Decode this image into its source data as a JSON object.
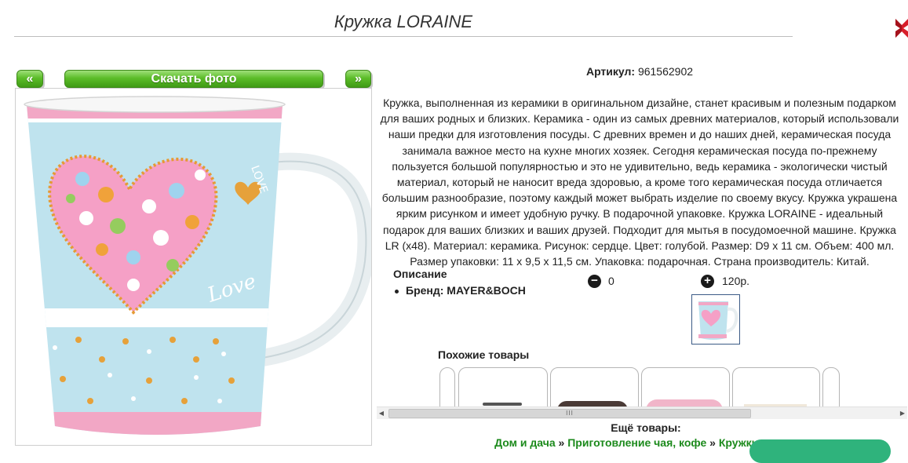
{
  "header": {
    "title": "Кружка LORAINE"
  },
  "nav": {
    "prev_label": "«",
    "download_label": "Скачать фото",
    "next_label": "»"
  },
  "product": {
    "article_label": "Артикул:",
    "article_value": "961562902",
    "description": "Кружка, выполненная из керамики в оригинальном дизайне, станет красивым и полезным подарком для ваших родных и близких. Керамика - один из самых древних материалов, который использовали наши предки для изготовления посуды. С древних времен и до наших дней, керамическая посуда занимала важное место на кухне многих хозяек. Сегодня керамическая посуда по-прежнему пользуется большой популярностью и это не удивительно, ведь керамика - экологически чистый материал, который не наносит вреда здоровью, а кроме того керамическая посуда отличается большим разнообразие, поэтому каждый может выбрать изделие по своему вкусу. Кружка украшена ярким рисунком и имеет удобную ручку. В подарочной упаковке. Кружка LORAINE - идеальный подарок для ваших близких и ваших друзей. Подходит для мытья в посудомоечной машине. Кружка LR (х48). Материал: керамика. Рисунок: сердце. Цвет: голубой. Размер: D9 х 11 см. Объем: 400 мл. Размер упаковки: 11 х 9,5 х 11,5 см. Упаковка: подарочная. Страна производитель: Китай.",
    "description_label": "Описание",
    "brand_item": "Бренд: MAYER&BOCH",
    "quantity": "0",
    "price": "120р.",
    "minus_symbol": "−",
    "plus_symbol": "+"
  },
  "similar": {
    "label": "Похожие товары",
    "scroll_grip": "III",
    "scroll_left": "◀",
    "scroll_right": "▶"
  },
  "more": {
    "label": "Ещё товары:",
    "breadcrumb": [
      "Дом и дача",
      "Приготовление чая, кофе",
      "Кружки и чашки"
    ],
    "separator": "»"
  },
  "colors": {
    "accent_green": "#5cbd29",
    "link_green": "#1c8a1c",
    "mug_blue": "#bfe3ee",
    "mug_pink": "#f2a7c5",
    "close_red": "#d81e2a"
  },
  "icons": [
    "close-icon",
    "minus-icon",
    "plus-icon"
  ]
}
